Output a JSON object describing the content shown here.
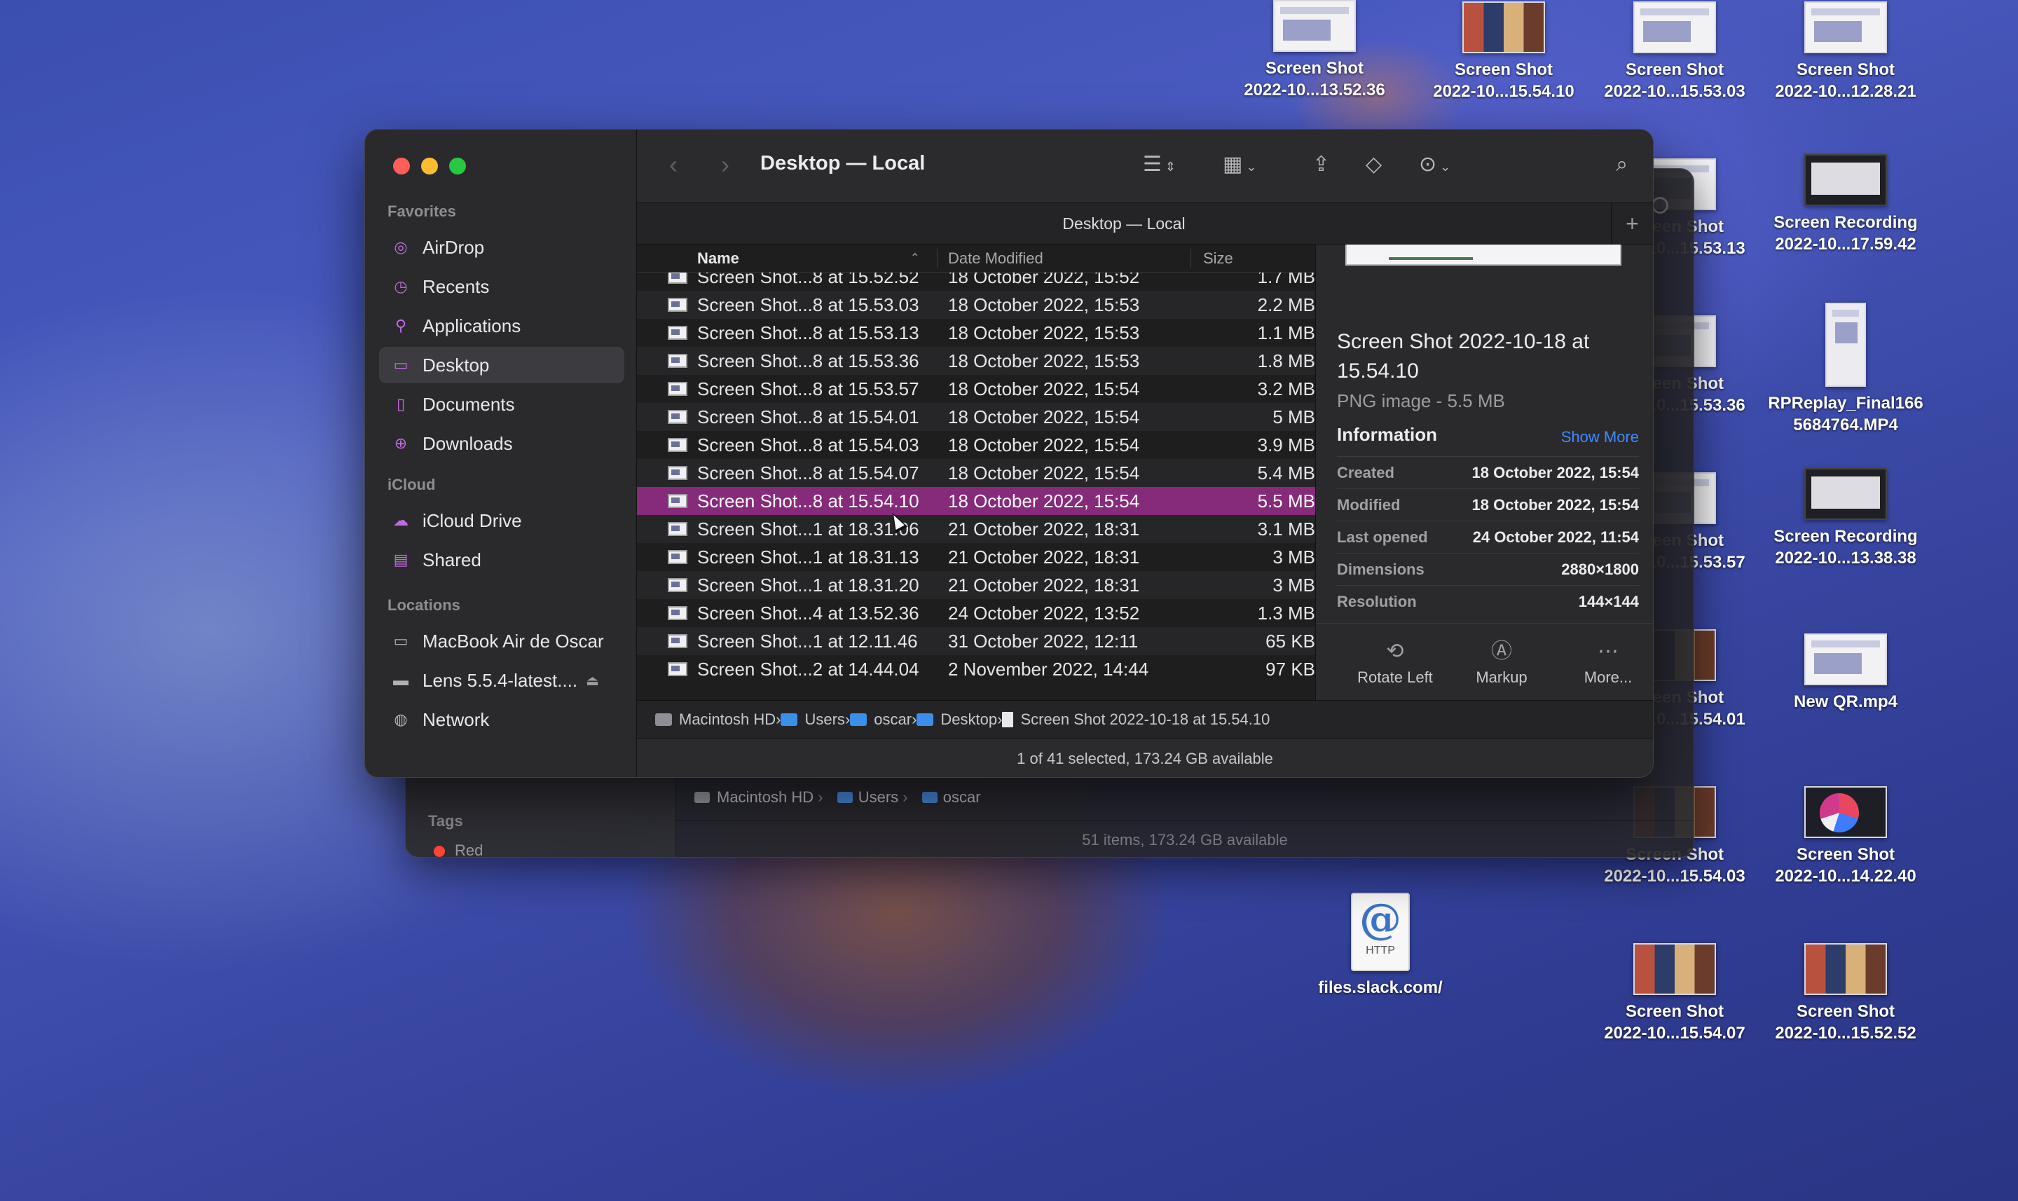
{
  "desktop": {
    "icons": [
      {
        "name": "Screen Shot\n2022-10...13.52.36",
        "kind": "thumb"
      },
      {
        "name": "Screen Shot\n2022-10...15.54.10",
        "kind": "photo"
      },
      {
        "name": "Screen Shot\n2022-10...15.53.03",
        "kind": "thumb"
      },
      {
        "name": "Screen Shot\n2022-10...12.28.21",
        "kind": "thumb"
      },
      {
        "name": "Screen Shot\n2022-10...15.53.13",
        "kind": "thumb"
      },
      {
        "name": "Screen Recording\n2022-10...17.59.42",
        "kind": "video"
      },
      {
        "name": "Screen Shot\n2022-10...15.53.36",
        "kind": "thumb"
      },
      {
        "name": "RPReplay_Final166\n5684764.MP4",
        "kind": "phone"
      },
      {
        "name": "Screen Shot\n2022-10...15.53.57",
        "kind": "thumb"
      },
      {
        "name": "Screen Recording\n2022-10...13.38.38",
        "kind": "video"
      },
      {
        "name": "Screen Shot\n2022-10...15.54.01",
        "kind": "photo"
      },
      {
        "name": "New QR.mp4",
        "kind": "thumb"
      },
      {
        "name": "Screen Shot\n2022-10...15.54.03",
        "kind": "photo"
      },
      {
        "name": "Screen Shot\n2022-10...14.22.40",
        "kind": "pie"
      },
      {
        "name": "Screen Shot\n2022-10...15.54.07",
        "kind": "photo"
      },
      {
        "name": "Screen Shot\n2022-10...15.52.52",
        "kind": "photo"
      },
      {
        "name": "files.slack.com/",
        "kind": "http",
        "glyph": "@",
        "sublabel": "HTTP"
      }
    ]
  },
  "back_window": {
    "tags_label": "Tags",
    "tag_red": "Red",
    "path": [
      "Macintosh HD",
      "Users",
      "oscar"
    ],
    "status": "51 items, 173.24 GB available"
  },
  "finder": {
    "title": "Desktop — Local",
    "tab_title": "Desktop — Local",
    "sidebar": {
      "favorites_label": "Favorites",
      "favorites": [
        {
          "label": "AirDrop",
          "icon": "airdrop-icon"
        },
        {
          "label": "Recents",
          "icon": "clock-icon"
        },
        {
          "label": "Applications",
          "icon": "applications-icon"
        },
        {
          "label": "Desktop",
          "icon": "desktop-icon",
          "selected": true
        },
        {
          "label": "Documents",
          "icon": "document-icon"
        },
        {
          "label": "Downloads",
          "icon": "download-icon"
        }
      ],
      "icloud_label": "iCloud",
      "icloud": [
        {
          "label": "iCloud Drive",
          "icon": "cloud-icon"
        },
        {
          "label": "Shared",
          "icon": "shared-folder-icon"
        }
      ],
      "locations_label": "Locations",
      "locations": [
        {
          "label": "MacBook Air de Oscar",
          "icon": "laptop-icon"
        },
        {
          "label": "Lens 5.5.4-latest....",
          "icon": "disk-icon"
        },
        {
          "label": "Network",
          "icon": "globe-icon"
        }
      ]
    },
    "columns": {
      "name": "Name",
      "date": "Date Modified",
      "size": "Size"
    },
    "files": [
      {
        "name": "Screen Shot...8 at 15.52.52",
        "date": "18 October 2022, 15:52",
        "size": "1.7 MB"
      },
      {
        "name": "Screen Shot...8 at 15.53.03",
        "date": "18 October 2022, 15:53",
        "size": "2.2 MB"
      },
      {
        "name": "Screen Shot...8 at 15.53.13",
        "date": "18 October 2022, 15:53",
        "size": "1.1 MB"
      },
      {
        "name": "Screen Shot...8 at 15.53.36",
        "date": "18 October 2022, 15:53",
        "size": "1.8 MB"
      },
      {
        "name": "Screen Shot...8 at 15.53.57",
        "date": "18 October 2022, 15:54",
        "size": "3.2 MB"
      },
      {
        "name": "Screen Shot...8 at 15.54.01",
        "date": "18 October 2022, 15:54",
        "size": "5 MB"
      },
      {
        "name": "Screen Shot...8 at 15.54.03",
        "date": "18 October 2022, 15:54",
        "size": "3.9 MB"
      },
      {
        "name": "Screen Shot...8 at 15.54.07",
        "date": "18 October 2022, 15:54",
        "size": "5.4 MB"
      },
      {
        "name": "Screen Shot...8 at 15.54.10",
        "date": "18 October 2022, 15:54",
        "size": "5.5 MB",
        "selected": true
      },
      {
        "name": "Screen Shot...1 at 18.31.06",
        "date": "21 October 2022, 18:31",
        "size": "3.1 MB"
      },
      {
        "name": "Screen Shot...1 at 18.31.13",
        "date": "21 October 2022, 18:31",
        "size": "3 MB"
      },
      {
        "name": "Screen Shot...1 at 18.31.20",
        "date": "21 October 2022, 18:31",
        "size": "3 MB"
      },
      {
        "name": "Screen Shot...4 at 13.52.36",
        "date": "24 October 2022, 13:52",
        "size": "1.3 MB"
      },
      {
        "name": "Screen Shot...1 at 12.11.46",
        "date": "31 October 2022, 12:11",
        "size": "65 KB"
      },
      {
        "name": "Screen Shot...2 at 14.44.04",
        "date": "2 November 2022, 14:44",
        "size": "97 KB"
      }
    ],
    "preview": {
      "title": "Screen Shot 2022-10-18 at 15.54.10",
      "kind": "PNG image - 5.5 MB",
      "info_label": "Information",
      "show_more": "Show More",
      "info": [
        {
          "k": "Created",
          "v": "18 October 2022, 15:54"
        },
        {
          "k": "Modified",
          "v": "18 October 2022, 15:54"
        },
        {
          "k": "Last opened",
          "v": "24 October 2022, 11:54"
        },
        {
          "k": "Dimensions",
          "v": "2880×1800"
        },
        {
          "k": "Resolution",
          "v": "144×144"
        }
      ],
      "actions": [
        {
          "label": "Rotate Left",
          "icon": "rotate-left-icon",
          "glyph": "⟲"
        },
        {
          "label": "Markup",
          "icon": "markup-icon",
          "glyph": "Ⓐ"
        },
        {
          "label": "More...",
          "icon": "more-icon",
          "glyph": "⋯"
        }
      ]
    },
    "path": [
      "Macintosh HD",
      "Users",
      "oscar",
      "Desktop",
      "Screen Shot 2022-10-18 at 15.54.10"
    ],
    "status": "1 of 41 selected, 173.24 GB available"
  }
}
